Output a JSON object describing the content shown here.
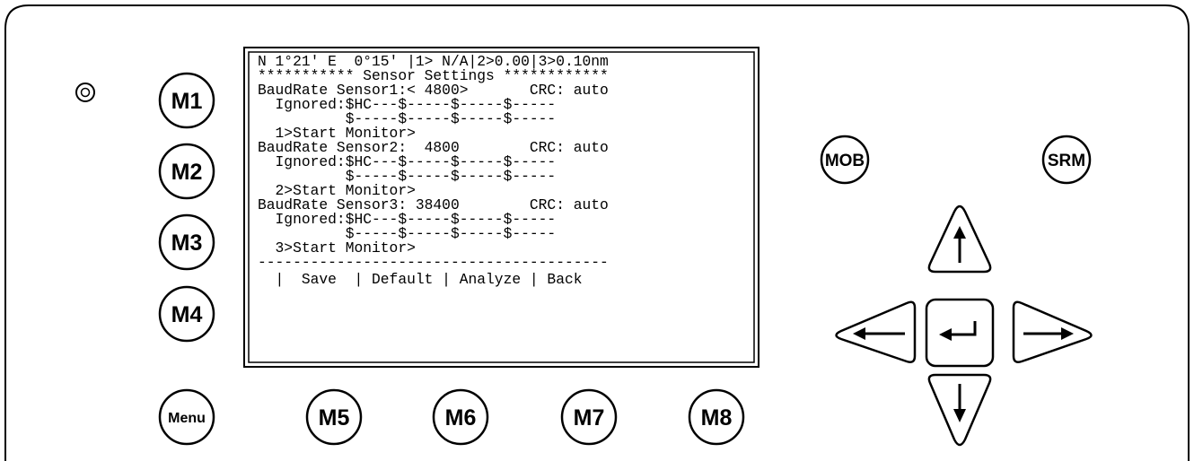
{
  "screen": {
    "lines": [
      "N 1°21' E  0°15' |1> N/A|2>0.00|3>0.10nm",
      "*********** Sensor Settings ************",
      "BaudRate Sensor1:< 4800>       CRC: auto",
      "  Ignored:$HC---$-----$-----$-----",
      "          $-----$-----$-----$-----",
      "  1>Start Monitor>",
      "BaudRate Sensor2:  4800        CRC: auto",
      "  Ignored:$HC---$-----$-----$-----",
      "          $-----$-----$-----$-----",
      "  2>Start Monitor>",
      "BaudRate Sensor3: 38400        CRC: auto",
      "  Ignored:$HC---$-----$-----$-----",
      "          $-----$-----$-----$-----",
      "  3>Start Monitor>",
      "----------------------------------------",
      "  |  Save  | Default | Analyze | Back"
    ]
  },
  "buttons": {
    "m1": "M1",
    "m2": "M2",
    "m3": "M3",
    "m4": "M4",
    "menu": "Menu",
    "m5": "M5",
    "m6": "M6",
    "m7": "M7",
    "m8": "M8",
    "mob": "MOB",
    "srm": "SRM"
  },
  "icons": {
    "up": "arrow-up-icon",
    "down": "arrow-down-icon",
    "left": "arrow-left-icon",
    "right": "arrow-right-icon",
    "enter": "enter-icon",
    "power": "power-led-icon"
  }
}
